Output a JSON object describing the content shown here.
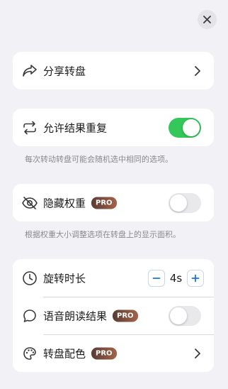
{
  "share": {
    "label": "分享转盘"
  },
  "repeat": {
    "label": "允许结果重复",
    "enabled": true,
    "note": "每次转动转盘可能会随机选中相同的选项。"
  },
  "hide_weight": {
    "label": "隐藏权重",
    "badge": "PRO",
    "enabled": false,
    "note": "根据权重大小调整选项在转盘上的显示面积。"
  },
  "settings": {
    "duration": {
      "label": "旋转时长",
      "value": "4s"
    },
    "voice": {
      "label": "语音朗读结果",
      "badge": "PRO",
      "enabled": false
    },
    "color": {
      "label": "转盘配色",
      "badge": "PRO"
    }
  },
  "colors": {
    "toggle_on": "#34c759",
    "accent": "#1a73e8",
    "pro_badge": "#8a5240"
  },
  "icons": [
    "close-icon",
    "share-icon",
    "repeat-icon",
    "eye-off-icon",
    "clock-icon",
    "chat-bubble-icon",
    "palette-icon",
    "chevron-right-icon",
    "minus-icon",
    "plus-icon"
  ]
}
